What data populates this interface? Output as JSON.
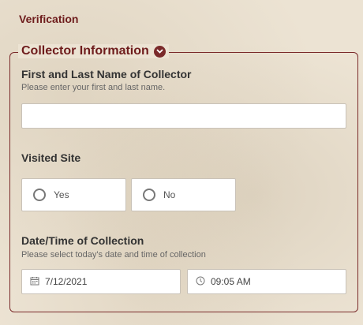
{
  "header": {
    "title": "Verification"
  },
  "section": {
    "title": "Collector Information",
    "toggle_icon": "chevron-down-icon"
  },
  "collector_name": {
    "label": "First and Last Name of Collector",
    "description": "Please enter your first and last name.",
    "value": ""
  },
  "visited_site": {
    "label": "Visited Site",
    "options": [
      {
        "label": "Yes",
        "selected": false
      },
      {
        "label": "No",
        "selected": false
      }
    ]
  },
  "collection_datetime": {
    "label": "Date/Time of Collection",
    "description": "Please select today's date and time of collection",
    "date_value": "7/12/2021",
    "date_icon": "calendar-icon",
    "time_value": "09:05 AM",
    "time_icon": "clock-icon"
  },
  "colors": {
    "accent": "#6e1c1c",
    "border": "#7a2a2a",
    "background": "#ece3d3"
  }
}
